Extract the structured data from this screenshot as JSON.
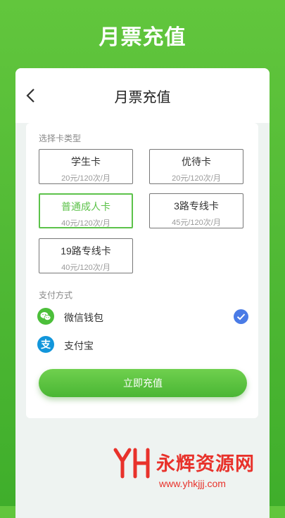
{
  "banner": {
    "title": "月票充值"
  },
  "nav": {
    "title": "月票充值",
    "back_icon": "chevron-left-icon"
  },
  "card_section": {
    "label": "选择卡类型",
    "options": [
      {
        "name": "学生卡",
        "price": "20元/120次/月",
        "selected": false
      },
      {
        "name": "优待卡",
        "price": "20元/120次/月",
        "selected": false
      },
      {
        "name": "普通成人卡",
        "price": "40元/120次/月",
        "selected": true
      },
      {
        "name": "3路专线卡",
        "price": "45元/120次/月",
        "selected": false
      },
      {
        "name": "19路专线卡",
        "price": "40元/120次/月",
        "selected": false
      }
    ]
  },
  "payment": {
    "label": "支付方式",
    "methods": [
      {
        "name": "微信钱包",
        "icon": "wechat-icon",
        "selected": true
      },
      {
        "name": "支付宝",
        "icon": "alipay-icon",
        "selected": false
      }
    ]
  },
  "submit": {
    "label": "立即充值"
  },
  "watermark": {
    "text": "永辉资源网",
    "url": "www.yhkjjj.com"
  },
  "colors": {
    "accent": "#5cc24a",
    "wechat": "#4cbf3a",
    "alipay": "#1296db",
    "check": "#4a7be6"
  }
}
